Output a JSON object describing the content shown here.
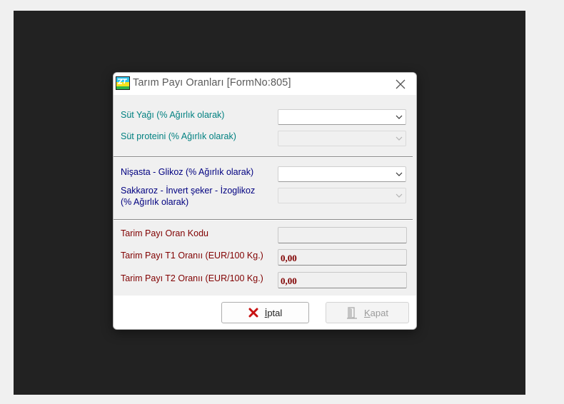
{
  "window": {
    "title": "Tarım Payı Oranları [FormNo:805]",
    "icon": "ztr-app-icon"
  },
  "section1": {
    "fields": [
      {
        "label": "Süt Yağı (% Ağırlık olarak)",
        "value": "",
        "enabled": true
      },
      {
        "label": "Süt proteini (% Ağırlık olarak)",
        "value": "",
        "enabled": false
      }
    ]
  },
  "section2": {
    "fields": [
      {
        "label": "Nişasta - Glikoz (% Ağırlık olarak)",
        "value": "",
        "enabled": true
      },
      {
        "label_line1": "Sakkaroz - İnvert şeker - İzoglikoz",
        "label_line2": "(% Ağırlık olarak)",
        "value": "",
        "enabled": false
      }
    ]
  },
  "section3": {
    "oran_kodu": {
      "label": "Tarim Payı Oran Kodu",
      "value": ""
    },
    "t1": {
      "label": "Tarim Payı T1 Oranıı (EUR/100 Kg.)",
      "value": "0,00"
    },
    "t2": {
      "label": "Tarim Payı T2 Oranıı (EUR/100 Kg.)",
      "value": "0,00"
    }
  },
  "buttons": {
    "cancel": {
      "prefix": "İ",
      "rest": "ptal",
      "icon": "red-x-icon"
    },
    "close": {
      "prefix": "K",
      "rest": "apat",
      "icon": "door-exit-icon"
    }
  },
  "colors": {
    "section1_label": "#008080",
    "section2_label": "#000080",
    "section3_label": "#800000",
    "value_text": "#800000",
    "backdrop": "#222222"
  }
}
